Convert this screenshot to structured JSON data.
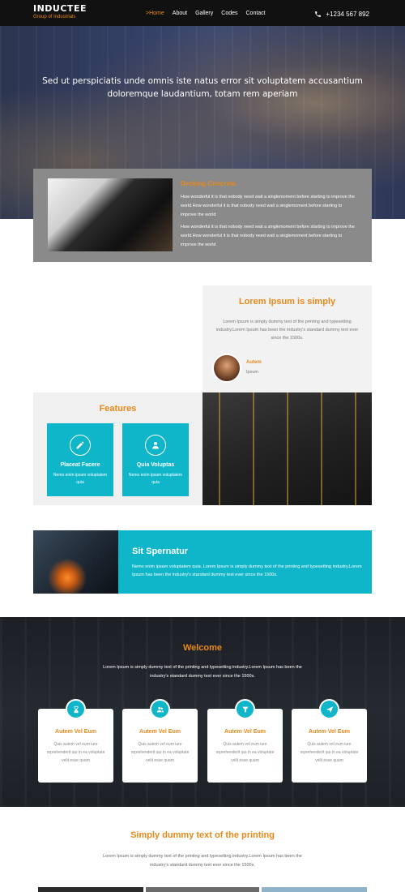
{
  "nav": {
    "brand_title": "INDUCTEE",
    "brand_sub": "Group of Industrials",
    "items": [
      "Home",
      "About",
      "Gallery",
      "Codes",
      "Contact"
    ],
    "phone": "+1234 567 892"
  },
  "hero": {
    "text": "Sed ut perspiciatis unde omnis iste natus error sit voluptatem accusantium doloremque laudantium, totam rem aperiam"
  },
  "deck": {
    "title": "Decking Concrete",
    "p1": "How wonderful it is that nobody need wait a singlemoment before starting to improve the world.How wonderful it is that nobody need wait a singlemoment before starting to improve the world",
    "p2": "How wonderful it is that nobody need wait a singlemoment before starting to improve the world.How wonderful it is that nobody need wait a singlemoment before starting to improve the world"
  },
  "lorem": {
    "title": "Lorem Ipsum is simply",
    "text": "Lorem Ipsum is simply dummy text of the printing and typesetting industry.Lorem Ipsum has been the industry's standard dummy text ever since the 1500s.",
    "person_name": "Autem",
    "person_role": "Ipsum"
  },
  "features": {
    "title": "Features",
    "cards": [
      {
        "title": "Placeat Facere",
        "text": "Nemo enim ipsam voluptatem quia"
      },
      {
        "title": "Quia Voluptas",
        "text": "Nemo enim ipsam voluptatem quia"
      }
    ]
  },
  "sit": {
    "title": "Sit Spernatur",
    "text": "Nemo enim ipsam voluptatem quia. Lorem Ipsum is simply dummy text of the printing and typesetting industry.Lorem Ipsum has been the industry's standard dummy text ever since the 1500s."
  },
  "welcome": {
    "title": "Welcome",
    "text": "Lorem Ipsum is simply dummy text of the printing and typesetting industry.Lorem Ipsum has been the industry's standard dummy text ever since the 1500s.",
    "cards": [
      {
        "title": "Autem Vel Eum",
        "text": "Quis autem vel eum iure reprehenderit qui in ea voluptate velit esse quam",
        "icon": "hourglass-icon"
      },
      {
        "title": "Autem Vel Eum",
        "text": "Quis autem vel eum iure reprehenderit qui in ea voluptate velit esse quam",
        "icon": "users-icon"
      },
      {
        "title": "Autem Vel Eum",
        "text": "Quis autem vel eum iure reprehenderit qui in ea voluptate velit esse quam",
        "icon": "filter-icon"
      },
      {
        "title": "Autem Vel Eum",
        "text": "Quis autem vel eum iure reprehenderit qui in ea voluptate velit esse quam",
        "icon": "plane-icon"
      }
    ]
  },
  "dummy": {
    "title": "Simply dummy text of the printing",
    "text": "Lorem Ipsum is simply dummy text of the printing and typesetting industry.Lorem Ipsum has been the industry's standard dummy text ever since the 1500s."
  },
  "colors": {
    "accent": "#e8891a",
    "teal": "#0fb5c8",
    "nav_bg": "#111111"
  }
}
